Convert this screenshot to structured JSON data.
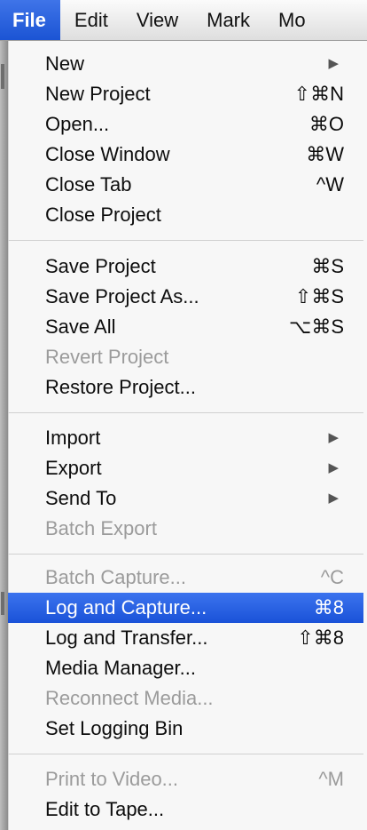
{
  "menubar": {
    "items": [
      "File",
      "Edit",
      "View",
      "Mark",
      "Mo"
    ]
  },
  "file_menu": {
    "items": [
      {
        "label": "New",
        "shortcut": "",
        "submenu": true,
        "icon": "submenu-arrow-icon",
        "enabled": true
      },
      {
        "label": "New Project",
        "shortcut": "⇧⌘N",
        "submenu": false,
        "enabled": true
      },
      {
        "label": "Open...",
        "shortcut": "⌘O",
        "submenu": false,
        "enabled": true
      },
      {
        "label": "Close Window",
        "shortcut": "⌘W",
        "submenu": false,
        "enabled": true
      },
      {
        "label": "Close Tab",
        "shortcut": "^W",
        "submenu": false,
        "enabled": true
      },
      {
        "label": "Close Project",
        "shortcut": "",
        "submenu": false,
        "enabled": true
      },
      {
        "label": "Save Project",
        "shortcut": "⌘S",
        "submenu": false,
        "enabled": true
      },
      {
        "label": "Save Project As...",
        "shortcut": "⇧⌘S",
        "submenu": false,
        "enabled": true
      },
      {
        "label": "Save All",
        "shortcut": "⌥⌘S",
        "submenu": false,
        "enabled": true
      },
      {
        "label": "Revert Project",
        "shortcut": "",
        "submenu": false,
        "enabled": false
      },
      {
        "label": "Restore Project...",
        "shortcut": "",
        "submenu": false,
        "enabled": true
      },
      {
        "label": "Import",
        "shortcut": "",
        "submenu": true,
        "icon": "submenu-arrow-icon",
        "enabled": true
      },
      {
        "label": "Export",
        "shortcut": "",
        "submenu": true,
        "icon": "submenu-arrow-icon",
        "enabled": true
      },
      {
        "label": "Send To",
        "shortcut": "",
        "submenu": true,
        "icon": "submenu-arrow-icon",
        "enabled": true
      },
      {
        "label": "Batch Export",
        "shortcut": "",
        "submenu": false,
        "enabled": false
      },
      {
        "label": "Batch Capture...",
        "shortcut": "^C",
        "submenu": false,
        "enabled": false
      },
      {
        "label": "Log and Capture...",
        "shortcut": "⌘8",
        "submenu": false,
        "enabled": true,
        "highlighted": true
      },
      {
        "label": "Log and Transfer...",
        "shortcut": "⇧⌘8",
        "submenu": false,
        "enabled": true
      },
      {
        "label": "Media Manager...",
        "shortcut": "",
        "submenu": false,
        "enabled": true
      },
      {
        "label": "Reconnect Media...",
        "shortcut": "",
        "submenu": false,
        "enabled": false
      },
      {
        "label": "Set Logging Bin",
        "shortcut": "",
        "submenu": false,
        "enabled": true
      },
      {
        "label": "Print to Video...",
        "shortcut": "^M",
        "submenu": false,
        "enabled": false
      },
      {
        "label": "Edit to Tape...",
        "shortcut": "",
        "submenu": false,
        "enabled": true
      }
    ]
  },
  "colors": {
    "highlight": "#1f5bdc",
    "disabled_text": "#9b9b9b",
    "menu_background": "#f7f7f7"
  }
}
